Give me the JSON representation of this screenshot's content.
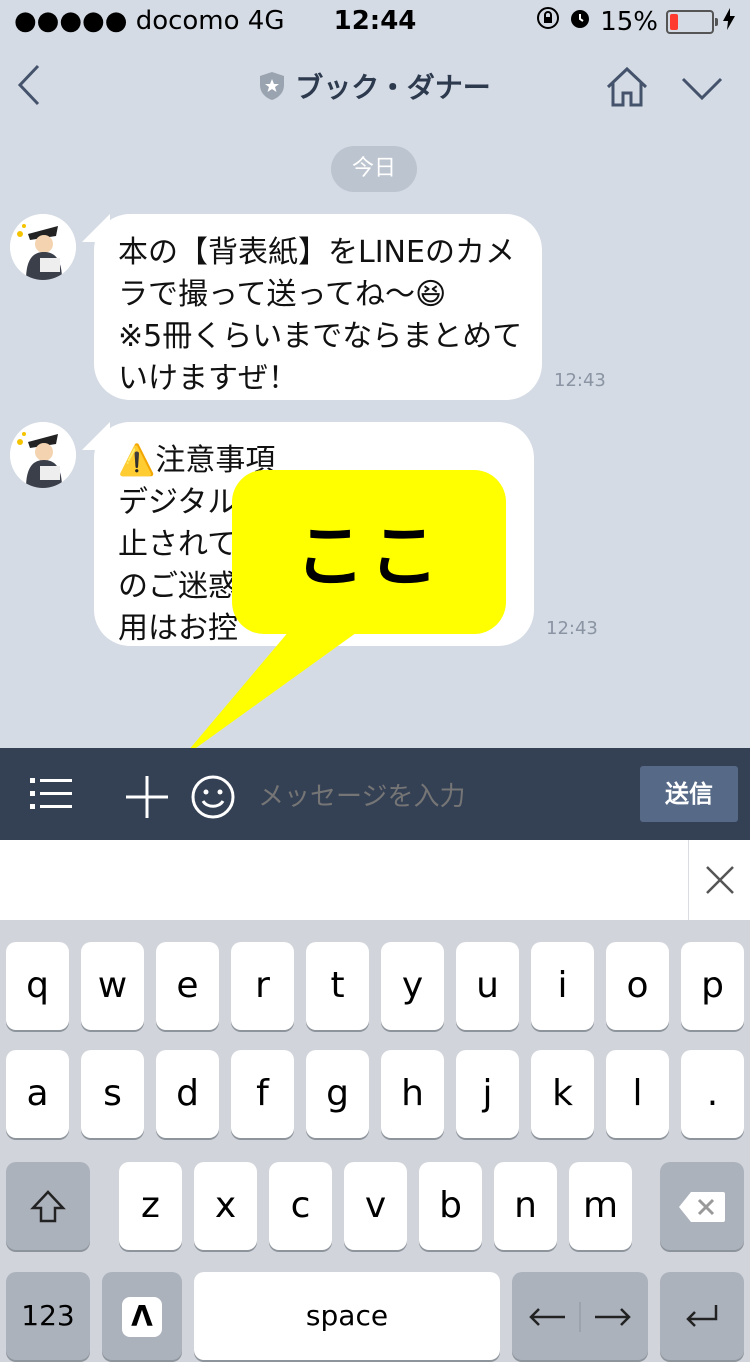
{
  "status_bar": {
    "carrier": "●●●●● docomo   4G",
    "time": "12:44",
    "battery": "15%"
  },
  "header": {
    "title": "ブック・ダナー"
  },
  "date_label": "今日",
  "messages": [
    {
      "lines": [
        "本の【背表紙】をLINEのカメ",
        "ラで撮って送ってね〜😆",
        "※5冊くらいまでならまとめて",
        "いけますぜ！"
      ],
      "time": "12:43"
    },
    {
      "lines": [
        "⚠️注意事項",
        "デジタル",
        "止されて",
        "のご迷惑",
        "用はお控"
      ],
      "time": "12:43"
    }
  ],
  "callout": {
    "text": "ここ",
    "color": "#ffff00"
  },
  "input_bar": {
    "placeholder": "メッセージを入力",
    "send_label": "送信"
  },
  "keyboard": {
    "row1": [
      "q",
      "w",
      "e",
      "r",
      "t",
      "y",
      "u",
      "i",
      "o",
      "p"
    ],
    "row2": [
      "a",
      "s",
      "d",
      "f",
      "g",
      "h",
      "j",
      "k",
      "l",
      "."
    ],
    "row3": [
      "z",
      "x",
      "c",
      "v",
      "b",
      "n",
      "m"
    ],
    "num_label": "123",
    "space_label": "space"
  },
  "colors": {
    "background": "#d4dbe5",
    "input_bar": "#344054",
    "send_button": "#566987"
  }
}
